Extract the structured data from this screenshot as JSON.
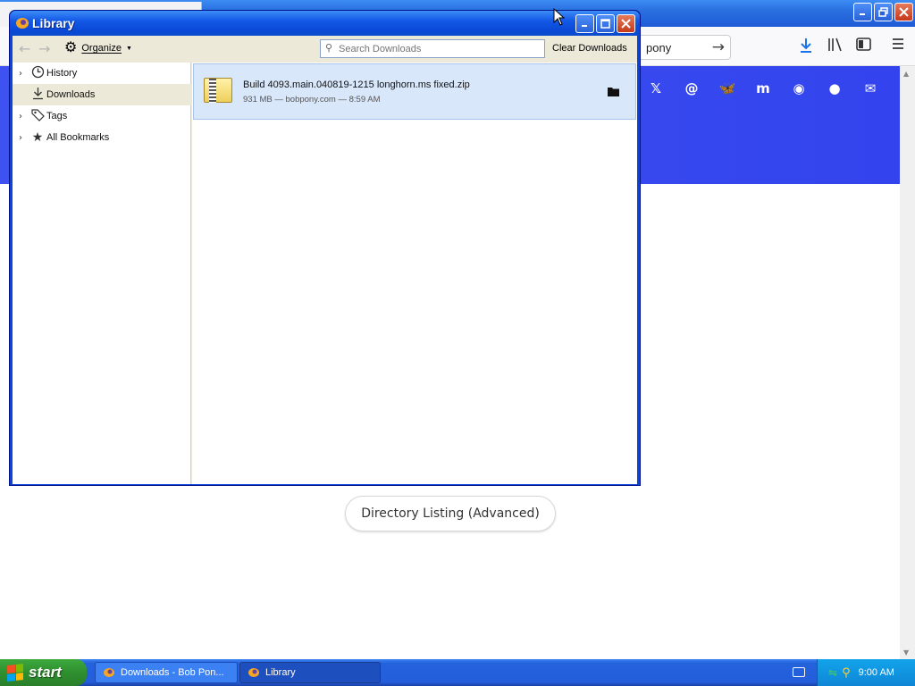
{
  "browser": {
    "address_text": "pony",
    "social_icons": [
      "x-icon",
      "threads-icon",
      "bluesky-icon",
      "mastodon-icon",
      "discord-icon",
      "github-icon",
      "mail-icon"
    ],
    "banner_color": "#3d52f0",
    "page_button_label": "Directory Listing (Advanced)"
  },
  "library": {
    "title": "Library",
    "organize_label": "Organize",
    "search_placeholder": "Search Downloads",
    "clear_label": "Clear Downloads",
    "sidebar": [
      {
        "label": "History",
        "icon": "clock-icon",
        "expandable": true,
        "selected": false
      },
      {
        "label": "Downloads",
        "icon": "download-icon",
        "expandable": false,
        "selected": true
      },
      {
        "label": "Tags",
        "icon": "tag-icon",
        "expandable": true,
        "selected": false
      },
      {
        "label": "All Bookmarks",
        "icon": "star-icon",
        "expandable": true,
        "selected": false
      }
    ],
    "downloads": [
      {
        "name": "Build 4093.main.040819-1215 longhorn.ms fixed.zip",
        "meta": "931 MB — bobpony.com — 8:59 AM"
      }
    ]
  },
  "taskbar": {
    "start_label": "start",
    "tasks": [
      {
        "label": "Downloads - Bob Pon..."
      },
      {
        "label": "Library"
      }
    ],
    "clock": "9:00 AM"
  },
  "colors": {
    "xp_title_blue": "#0a48d6",
    "selected_row": "#d9e7fa",
    "taskbar_blue": "#245edb",
    "start_green": "#2f8f2f"
  }
}
